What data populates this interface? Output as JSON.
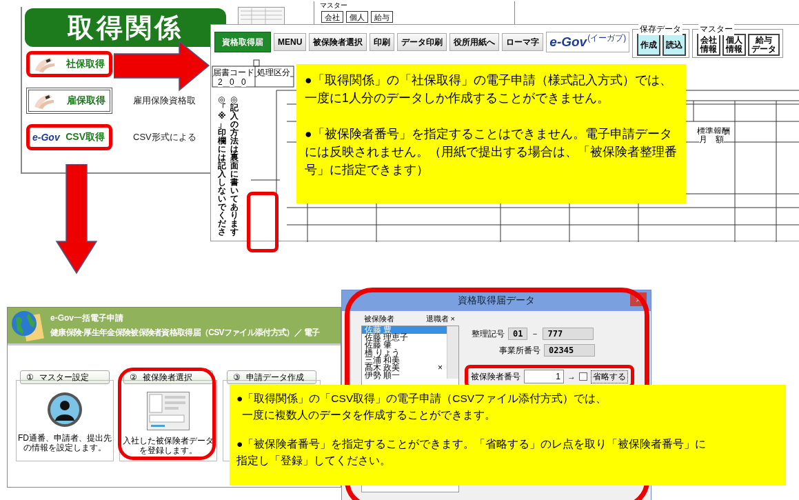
{
  "menu_panel": {
    "title": "取得関係",
    "items": [
      {
        "label": "社保取得",
        "kind": "hands",
        "highlighted": true
      },
      {
        "label": "雇保取得",
        "kind": "hands",
        "highlighted": false,
        "description": "雇用保険資格取"
      },
      {
        "label": "CSV取得",
        "kind": "egov",
        "logo": "e-Gov",
        "highlighted": true,
        "description": "CSV形式による"
      }
    ]
  },
  "back_master": {
    "title": "マスター",
    "buttons": [
      "会社",
      "個人",
      "給与"
    ]
  },
  "form_window": {
    "toolbar": [
      {
        "label": "資格取得届",
        "kind": "primary"
      },
      {
        "label": "MENU",
        "kind": "plain"
      },
      {
        "label": "被保険者選択",
        "kind": "plain"
      },
      {
        "label": "印刷",
        "kind": "plain"
      },
      {
        "label": "データ印刷",
        "kind": "plain"
      },
      {
        "label": "役所用紙へ",
        "kind": "plain"
      },
      {
        "label": "ローマ字",
        "kind": "plain"
      },
      {
        "label": "e-Gov",
        "sub": "(イーガブ)",
        "kind": "logo"
      }
    ],
    "groups": [
      {
        "title": "保存データ",
        "kind": "cyan",
        "buttons": [
          "作成",
          "読込"
        ]
      },
      {
        "title": "マスター",
        "kind": "plain",
        "buttons": [
          [
            "会社",
            "情報"
          ],
          [
            "個人",
            "情報"
          ],
          [
            "給与",
            "データ"
          ]
        ]
      }
    ],
    "form": {
      "code_label": "届書コード",
      "division_label": "処理区分",
      "code_digits": [
        "2",
        "0",
        "0"
      ],
      "pay_label": "標準報酬",
      "month_label": "月　額",
      "instructions": [
        "◎「※」印欄には記入しないでくださ",
        "◎記入の方法は裏面に書いてあります"
      ],
      "highlighted": true
    },
    "note": [
      "●「取得関係」の「社保取得」の電子申請（様式記入方式）では、一度に1人分のデータしか作成することができません。",
      "●「被保険者番号」を指定することはできません。電子申請データには反映されません。（用紙で提出する場合は、「被保険者整理番号」に指定できます）"
    ]
  },
  "egov_window": {
    "app_name": "e-Gov一括電子申請",
    "title": "健康保険·厚生年金保険被保険者資格取得届（CSVファイル添付方式）／ 電子",
    "steps": [
      {
        "number": "①",
        "label": "マスター設定",
        "kind": "person",
        "highlighted": false,
        "description": "FD通番、申請者、提出先の情報を設定します。"
      },
      {
        "number": "②",
        "label": "被保険者選択",
        "kind": "screenshot",
        "highlighted": true,
        "description": "入社した被保険者データを登録します。"
      },
      {
        "number": "③",
        "label": "申請データ作成",
        "kind": "none",
        "highlighted": false
      }
    ]
  },
  "dialog": {
    "title": "資格取得届データ",
    "close": "×",
    "list_header": "被保険者",
    "retired_header": "退職者 ×",
    "retired_mark": "×",
    "people": [
      {
        "name": "佐藤 豊",
        "selected": true,
        "retired": false
      },
      {
        "name": "佐藤 理恵子",
        "selected": false,
        "retired": false
      },
      {
        "name": "佐藤 肇",
        "selected": false,
        "retired": false
      },
      {
        "name": "橋 りょう",
        "selected": false,
        "retired": false
      },
      {
        "name": "三浦 和美",
        "selected": false,
        "retired": false
      },
      {
        "name": "髙木 政美",
        "selected": false,
        "retired": true
      },
      {
        "name": "伊勢 順一",
        "selected": false,
        "retired": false
      }
    ],
    "office_code_label": "整理記号",
    "office_code_1": "01",
    "dash": "－",
    "office_code_2": "777",
    "office_no_label": "事業所番号",
    "office_no": "02345",
    "insured_no_label": "被保険者番号",
    "insured_no": "1",
    "arrow": "→",
    "omit_checked": false,
    "omit_label": "省略する",
    "highlighted": true
  },
  "note2": [
    [
      "●「取得関係」の「CSV取得」の電子申請（CSVファイル添付方式）では、",
      "一度に複数人のデータを作成することができます。"
    ],
    [
      "●「被保険者番号」を指定することができます。「省略する」のレ点を取り「被保険者番号」に",
      "指定し「登録」してください。"
    ]
  ]
}
